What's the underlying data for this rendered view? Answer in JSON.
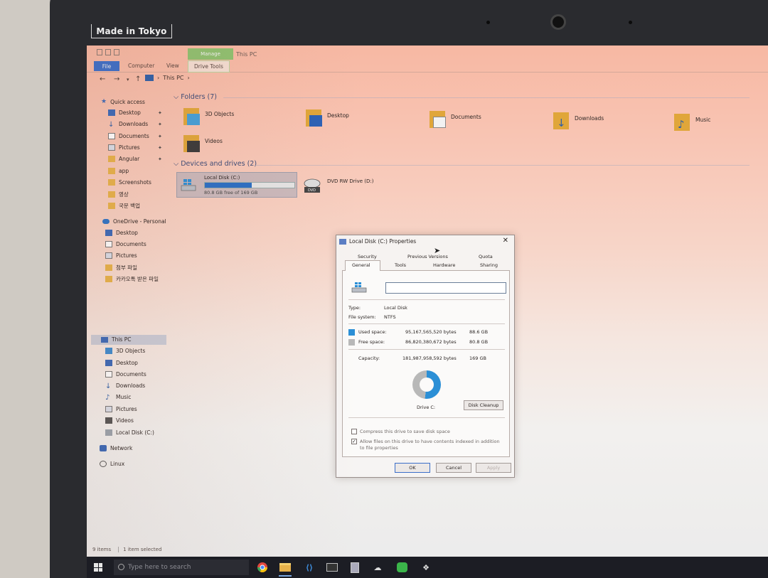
{
  "bezel": {
    "brand_text": "Made in Tokyo"
  },
  "window": {
    "title": "This PC",
    "context_tab": "Manage",
    "ribbon_tabs": [
      "File",
      "Computer",
      "View",
      "Drive Tools"
    ],
    "breadcrumb": [
      "This PC"
    ]
  },
  "nav": {
    "quick_access": "Quick access",
    "items": [
      {
        "label": "Desktop",
        "pinned": true
      },
      {
        "label": "Downloads",
        "pinned": true
      },
      {
        "label": "Documents",
        "pinned": true
      },
      {
        "label": "Pictures",
        "pinned": true
      },
      {
        "label": "Angular",
        "pinned": true
      },
      {
        "label": "app"
      },
      {
        "label": "Screenshots"
      },
      {
        "label": "영상"
      },
      {
        "label": "국문 백업"
      }
    ],
    "onedrive": "OneDrive - Personal",
    "onedrive_items": [
      "Desktop",
      "Documents",
      "Pictures",
      "첨부 파일",
      "카카오톡 받은 파일"
    ],
    "this_pc": "This PC",
    "this_pc_items": [
      "3D Objects",
      "Desktop",
      "Documents",
      "Downloads",
      "Music",
      "Pictures",
      "Videos",
      "Local Disk (C:)"
    ],
    "network": "Network",
    "linux": "Linux"
  },
  "content": {
    "folders_header": "Folders (7)",
    "folders": [
      "3D Objects",
      "Desktop",
      "Documents",
      "Downloads",
      "Music",
      "Videos"
    ],
    "devices_header": "Devices and drives (2)",
    "drive_c": {
      "name": "Local Disk (C:)",
      "free_text": "80.8 GB free of 169 GB",
      "used_fraction": 0.52
    },
    "drive_d": {
      "name": "DVD RW Drive (D:)",
      "badge": "DVD"
    }
  },
  "status": {
    "items": "9 items",
    "selected": "1 item selected"
  },
  "dialog": {
    "title": "Local Disk (C:) Properties",
    "tabs_row1": [
      "Security",
      "Previous Versions",
      "Quota"
    ],
    "tabs_row2": [
      "General",
      "Tools",
      "Hardware",
      "Sharing"
    ],
    "name_value": "",
    "type_label": "Type:",
    "type_value": "Local Disk",
    "fs_label": "File system:",
    "fs_value": "NTFS",
    "used_label": "Used space:",
    "used_bytes": "95,167,565,520 bytes",
    "used_gb": "88.6 GB",
    "free_label": "Free space:",
    "free_bytes": "86,820,380,672 bytes",
    "free_gb": "80.8 GB",
    "capacity_label": "Capacity:",
    "capacity_bytes": "181,987,958,592 bytes",
    "capacity_gb": "169 GB",
    "used_fraction": 0.52,
    "drive_label": "Drive C:",
    "cleanup_button": "Disk Cleanup",
    "compress_label": "Compress this drive to save disk space",
    "index_label": "Allow files on this drive to have contents indexed in addition to file properties",
    "compress_checked": false,
    "index_checked": true,
    "ok": "OK",
    "cancel": "Cancel",
    "apply": "Apply",
    "colors": {
      "used": "#2b8fd6",
      "free": "#b8b8b8"
    }
  },
  "taskbar": {
    "search_placeholder": "Type here to search",
    "apps": [
      "chrome-icon",
      "file-explorer-icon",
      "vscode-icon",
      "terminal-icon",
      "calculator-icon",
      "cloud-app-icon",
      "line-icon",
      "app-icon"
    ]
  }
}
